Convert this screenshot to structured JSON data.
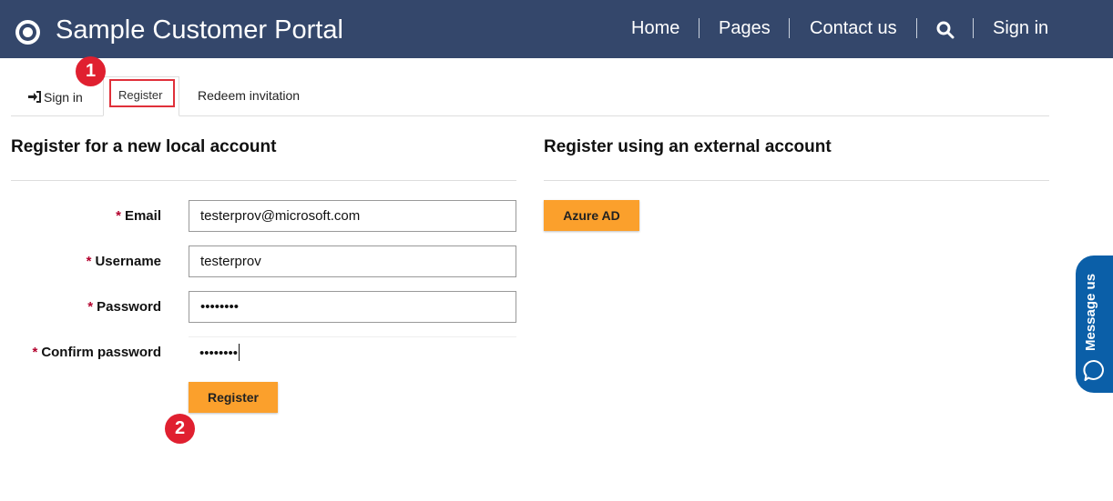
{
  "header": {
    "site_title": "Sample Customer Portal",
    "nav": {
      "home": "Home",
      "pages": "Pages",
      "contact": "Contact us",
      "signin": "Sign in"
    }
  },
  "tabs": {
    "signin": "Sign in",
    "register": "Register",
    "redeem": "Redeem invitation"
  },
  "annotations": {
    "badge1": "1",
    "badge2": "2"
  },
  "local": {
    "title": "Register for a new local account",
    "required_mark": "*",
    "email_label": "Email",
    "email_value": "testerprov@microsoft.com",
    "username_label": "Username",
    "username_value": "testerprov",
    "password_label": "Password",
    "password_value": "••••••••",
    "confirm_label": "Confirm password",
    "confirm_value": "••••••••",
    "register_button": "Register"
  },
  "external": {
    "title": "Register using an external account",
    "azure_button": "Azure AD"
  },
  "message_us": "Message us",
  "colors": {
    "header_bg": "#34476b",
    "accent_orange": "#fba02c",
    "badge_red": "#e02030",
    "message_blue": "#0b5fa8"
  }
}
